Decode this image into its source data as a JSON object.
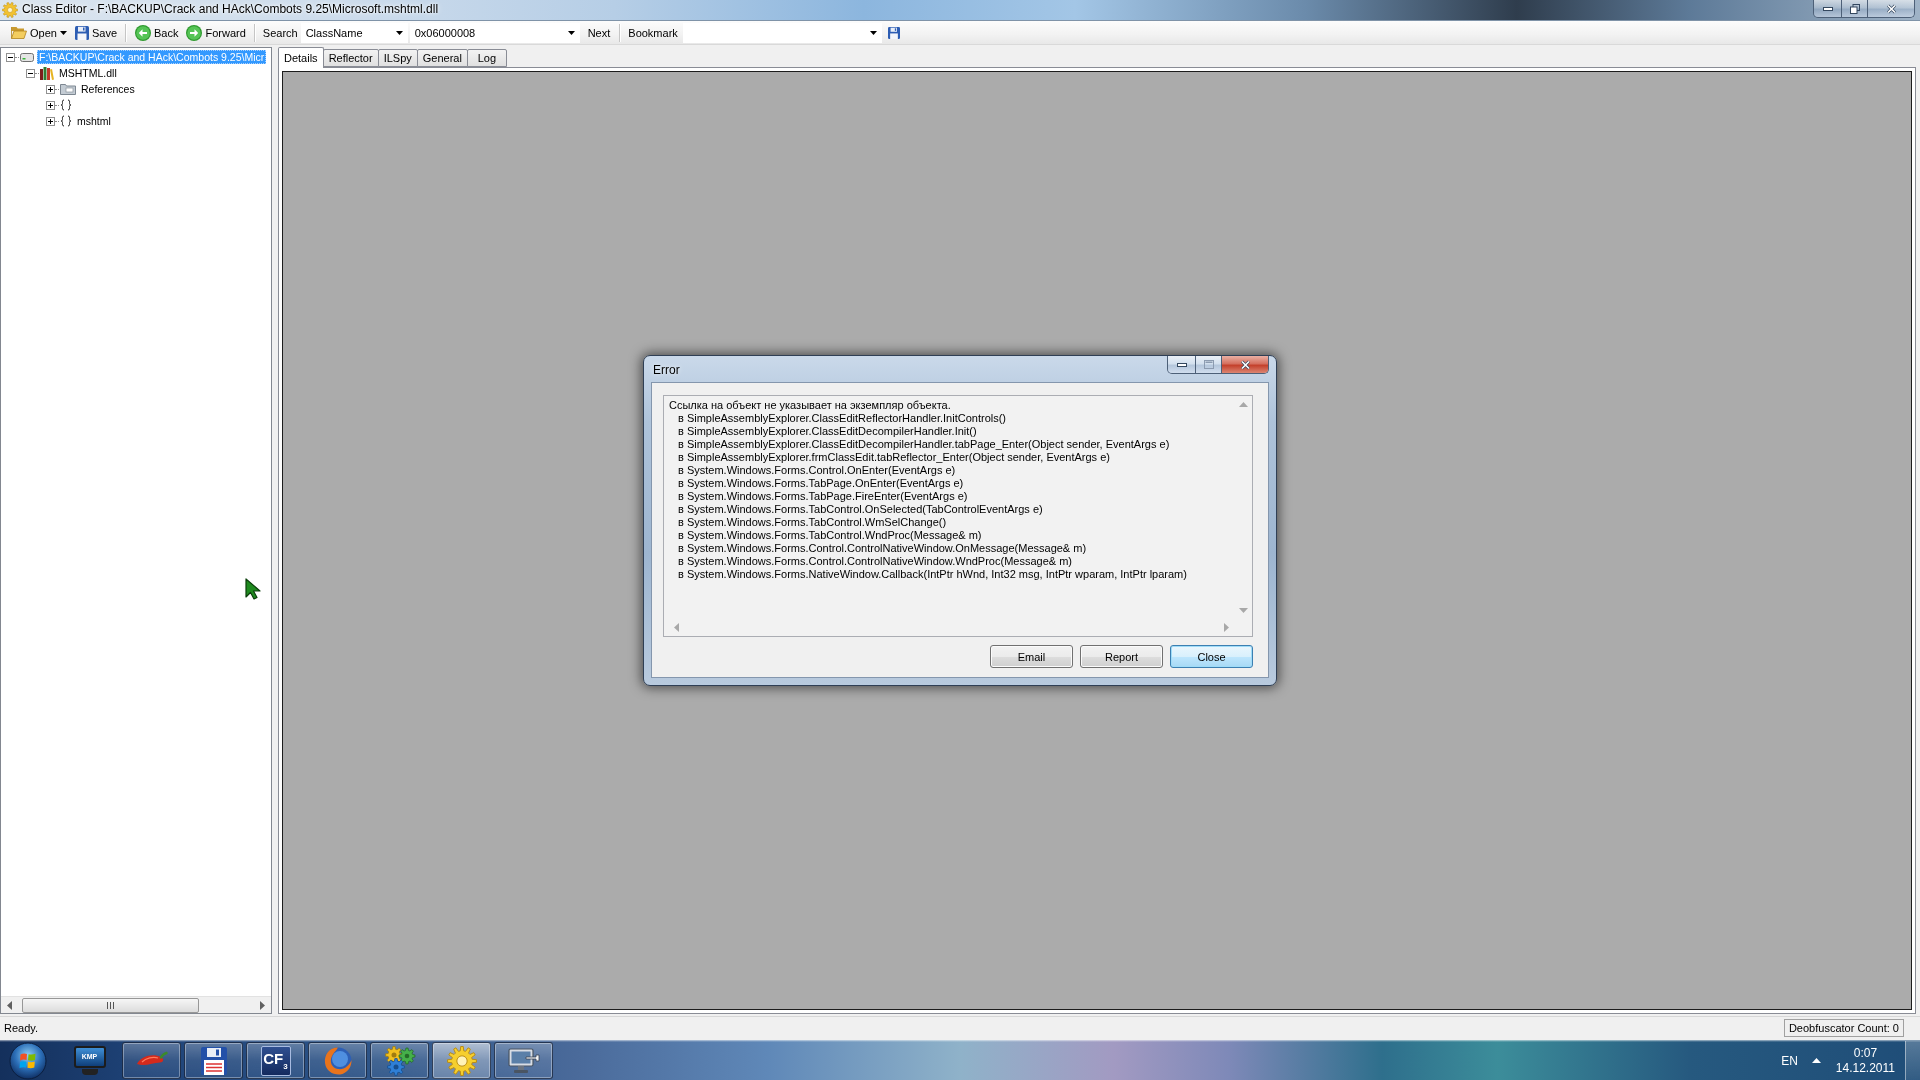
{
  "window": {
    "title": "Class Editor - F:\\BACKUP\\Crack and HAck\\Combots 9.25\\Microsoft.mshtml.dll"
  },
  "toolbar": {
    "button_groups": [
      [
        {
          "label": "Open",
          "dropdown": true
        },
        {
          "label": "Save",
          "dropdown": false
        }
      ],
      [
        {
          "label": "Back",
          "dropdown": false
        },
        {
          "label": "Forward",
          "dropdown": false
        }
      ]
    ],
    "search": {
      "label": "Search",
      "type_value": "ClassName",
      "query_value": "0x06000008",
      "next_button": "Next"
    },
    "bookmark": {
      "label": "Bookmark"
    }
  },
  "tree": {
    "items": [
      {
        "kind": "drive",
        "label": "F:\\BACKUP\\Crack and HAck\\Combots 9.25\\Micr",
        "selected": true,
        "expanded": true,
        "children": [
          {
            "kind": "assembly",
            "label": "MSHTML.dll",
            "selected": false,
            "expanded": true,
            "children": [
              {
                "kind": "folder",
                "label": "References",
                "selected": false,
                "expanded": false
              },
              {
                "kind": "namespace",
                "selected": false,
                "expanded": false
              },
              {
                "kind": "namespace",
                "label": "mshtml",
                "selected": false,
                "expanded": false
              }
            ]
          }
        ]
      }
    ]
  },
  "tabs": [
    {
      "label": "Details",
      "selected": true
    },
    {
      "label": "Reflector",
      "selected": false
    },
    {
      "label": "ILSpy",
      "selected": false
    },
    {
      "label": "General",
      "selected": false
    },
    {
      "label": "Log",
      "selected": false
    }
  ],
  "error_dialog": {
    "title": "Error",
    "details": {
      "message": "Ссылка на объект не указывает на экземпляр объекта.",
      "stack": [
        "в SimpleAssemblyExplorer.ClassEditReflectorHandler.InitControls()",
        "в SimpleAssemblyExplorer.ClassEditDecompilerHandler.Init()",
        "в SimpleAssemblyExplorer.ClassEditDecompilerHandler.tabPage_Enter(Object sender, EventArgs e)",
        "в SimpleAssemblyExplorer.frmClassEdit.tabReflector_Enter(Object sender, EventArgs e)",
        "в System.Windows.Forms.Control.OnEnter(EventArgs e)",
        "в System.Windows.Forms.TabPage.OnEnter(EventArgs e)",
        "в System.Windows.Forms.TabPage.FireEnter(EventArgs e)",
        "в System.Windows.Forms.TabControl.OnSelected(TabControlEventArgs e)",
        "в System.Windows.Forms.TabControl.WmSelChange()",
        "в System.Windows.Forms.TabControl.WndProc(Message& m)",
        "в System.Windows.Forms.Control.ControlNativeWindow.OnMessage(Message& m)",
        "в System.Windows.Forms.Control.ControlNativeWindow.WndProc(Message& m)",
        "в System.Windows.Forms.NativeWindow.Callback(IntPtr hWnd, Int32 msg, IntPtr wparam, IntPtr lparam)"
      ]
    },
    "buttons": [
      {
        "label": "Email",
        "default": false
      },
      {
        "label": "Report",
        "default": false
      },
      {
        "label": "Close",
        "default": true
      }
    ]
  },
  "status_bar": {
    "text": "Ready.",
    "deobfuscator_count": "Deobfuscator Count: 0"
  },
  "taskbar": {
    "apps": [
      {
        "running": false,
        "active": false,
        "logo_text": "KMP"
      },
      {
        "running": true,
        "active": false
      },
      {
        "running": true,
        "active": false
      },
      {
        "running": true,
        "active": false,
        "logo_text": "CF$_{3}$"
      },
      {
        "running": true,
        "active": false
      },
      {
        "running": true,
        "active": false
      },
      {
        "running": true,
        "active": true
      },
      {
        "running": true,
        "active": false
      }
    ],
    "tray": {
      "language": "EN",
      "time": "0:07",
      "date": "14.12.2011"
    }
  }
}
